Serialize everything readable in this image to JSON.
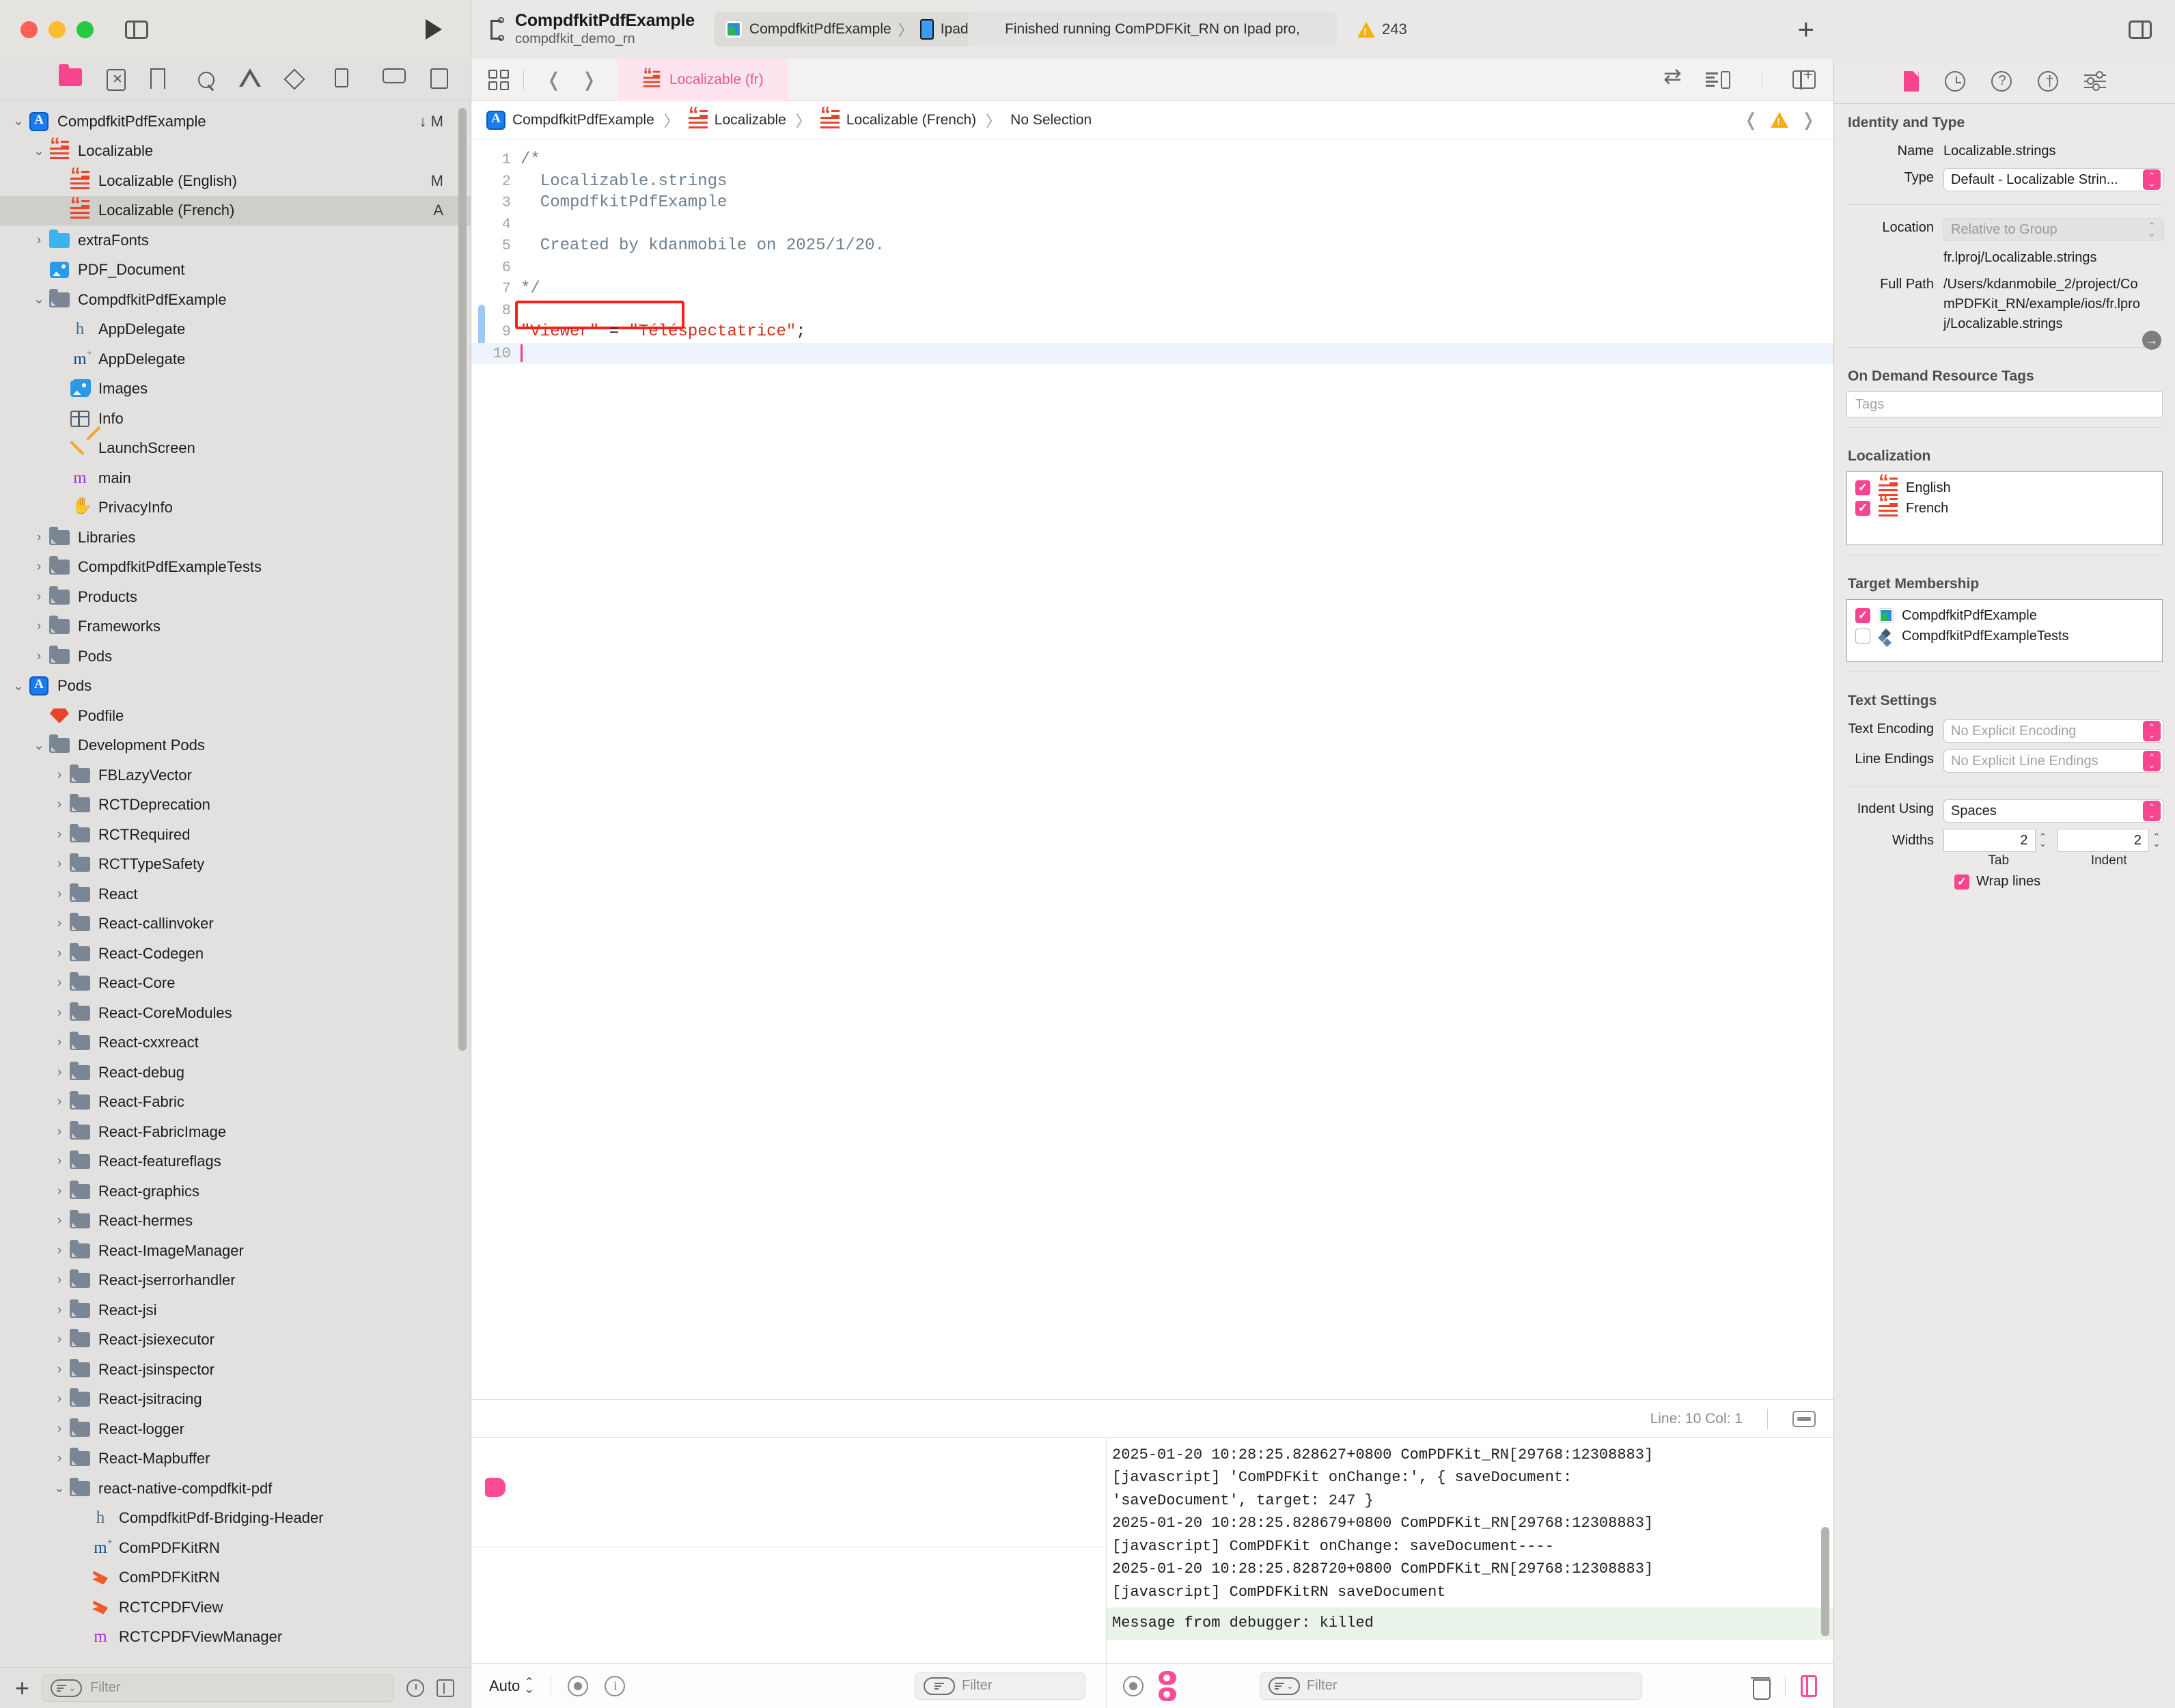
{
  "titlebar": {
    "scheme_name": "CompdfkitPdfExample",
    "scheme_sub": "compdfkit_demo_rn",
    "destination_project": "CompdfkitPdfExample",
    "destination_separator": "〉",
    "destination_device": "Ipad pro,",
    "status": "Finished running ComPDFKit_RN on Ipad pro,",
    "warning_count": "243",
    "add_label": "+"
  },
  "navigator": {
    "toolbar_icons": [
      "folder-icon",
      "source-control-icon",
      "bookmark-icon",
      "search-icon",
      "issue-icon",
      "test-icon",
      "debug-icon",
      "breakpoint-icon",
      "report-icon"
    ],
    "tree": [
      {
        "depth": 0,
        "disc": "⌄",
        "icon": "app-icon",
        "label": "CompdfkitPdfExample",
        "badge": "↓ M",
        "selected": false
      },
      {
        "depth": 1,
        "disc": "⌄",
        "icon": "strings-icon",
        "label": "Localizable",
        "badge": "",
        "selected": false
      },
      {
        "depth": 2,
        "disc": "",
        "icon": "strings-icon",
        "label": "Localizable (English)",
        "badge": "M",
        "selected": false
      },
      {
        "depth": 2,
        "disc": "",
        "icon": "strings-icon",
        "label": "Localizable (French)",
        "badge": "A",
        "selected": true
      },
      {
        "depth": 1,
        "disc": "›",
        "icon": "folder-blue-icon",
        "label": "extraFonts",
        "badge": "",
        "selected": false
      },
      {
        "depth": 1,
        "disc": "",
        "icon": "image-icon",
        "label": "PDF_Document",
        "badge": "",
        "selected": false
      },
      {
        "depth": 1,
        "disc": "⌄",
        "icon": "folder-gray-icon",
        "label": "CompdfkitPdfExample",
        "badge": "",
        "selected": false
      },
      {
        "depth": 2,
        "disc": "",
        "icon": "h-file-icon",
        "label": "AppDelegate",
        "badge": "",
        "selected": false
      },
      {
        "depth": 2,
        "disc": "",
        "icon": "m-file-icon",
        "label": "AppDelegate",
        "badge": "",
        "selected": false
      },
      {
        "depth": 2,
        "disc": "",
        "icon": "assets-icon",
        "label": "Images",
        "badge": "",
        "selected": false
      },
      {
        "depth": 2,
        "disc": "",
        "icon": "plist-icon",
        "label": "Info",
        "badge": "",
        "selected": false
      },
      {
        "depth": 2,
        "disc": "",
        "icon": "xib-icon",
        "label": "LaunchScreen",
        "badge": "",
        "selected": false
      },
      {
        "depth": 2,
        "disc": "",
        "icon": "m-purple-icon",
        "label": "main",
        "badge": "",
        "selected": false
      },
      {
        "depth": 2,
        "disc": "",
        "icon": "privacy-icon",
        "label": "PrivacyInfo",
        "badge": "",
        "selected": false
      },
      {
        "depth": 1,
        "disc": "›",
        "icon": "folder-gray-icon",
        "label": "Libraries",
        "badge": "",
        "selected": false
      },
      {
        "depth": 1,
        "disc": "›",
        "icon": "folder-gray-icon",
        "label": "CompdfkitPdfExampleTests",
        "badge": "",
        "selected": false
      },
      {
        "depth": 1,
        "disc": "›",
        "icon": "folder-gray-icon",
        "label": "Products",
        "badge": "",
        "selected": false
      },
      {
        "depth": 1,
        "disc": "›",
        "icon": "folder-gray-icon",
        "label": "Frameworks",
        "badge": "",
        "selected": false
      },
      {
        "depth": 1,
        "disc": "›",
        "icon": "folder-gray-icon",
        "label": "Pods",
        "badge": "",
        "selected": false
      },
      {
        "depth": 0,
        "disc": "⌄",
        "icon": "app-icon",
        "label": "Pods",
        "badge": "",
        "selected": false
      },
      {
        "depth": 1,
        "disc": "",
        "icon": "ruby-icon",
        "label": "Podfile",
        "badge": "",
        "selected": false
      },
      {
        "depth": 1,
        "disc": "⌄",
        "icon": "folder-gray-icon",
        "label": "Development Pods",
        "badge": "",
        "selected": false
      },
      {
        "depth": 2,
        "disc": "›",
        "icon": "folder-gray-icon",
        "label": "FBLazyVector",
        "badge": "",
        "selected": false
      },
      {
        "depth": 2,
        "disc": "›",
        "icon": "folder-gray-icon",
        "label": "RCTDeprecation",
        "badge": "",
        "selected": false
      },
      {
        "depth": 2,
        "disc": "›",
        "icon": "folder-gray-icon",
        "label": "RCTRequired",
        "badge": "",
        "selected": false
      },
      {
        "depth": 2,
        "disc": "›",
        "icon": "folder-gray-icon",
        "label": "RCTTypeSafety",
        "badge": "",
        "selected": false
      },
      {
        "depth": 2,
        "disc": "›",
        "icon": "folder-gray-icon",
        "label": "React",
        "badge": "",
        "selected": false
      },
      {
        "depth": 2,
        "disc": "›",
        "icon": "folder-gray-icon",
        "label": "React-callinvoker",
        "badge": "",
        "selected": false
      },
      {
        "depth": 2,
        "disc": "›",
        "icon": "folder-gray-icon",
        "label": "React-Codegen",
        "badge": "",
        "selected": false
      },
      {
        "depth": 2,
        "disc": "›",
        "icon": "folder-gray-icon",
        "label": "React-Core",
        "badge": "",
        "selected": false
      },
      {
        "depth": 2,
        "disc": "›",
        "icon": "folder-gray-icon",
        "label": "React-CoreModules",
        "badge": "",
        "selected": false
      },
      {
        "depth": 2,
        "disc": "›",
        "icon": "folder-gray-icon",
        "label": "React-cxxreact",
        "badge": "",
        "selected": false
      },
      {
        "depth": 2,
        "disc": "›",
        "icon": "folder-gray-icon",
        "label": "React-debug",
        "badge": "",
        "selected": false
      },
      {
        "depth": 2,
        "disc": "›",
        "icon": "folder-gray-icon",
        "label": "React-Fabric",
        "badge": "",
        "selected": false
      },
      {
        "depth": 2,
        "disc": "›",
        "icon": "folder-gray-icon",
        "label": "React-FabricImage",
        "badge": "",
        "selected": false
      },
      {
        "depth": 2,
        "disc": "›",
        "icon": "folder-gray-icon",
        "label": "React-featureflags",
        "badge": "",
        "selected": false
      },
      {
        "depth": 2,
        "disc": "›",
        "icon": "folder-gray-icon",
        "label": "React-graphics",
        "badge": "",
        "selected": false
      },
      {
        "depth": 2,
        "disc": "›",
        "icon": "folder-gray-icon",
        "label": "React-hermes",
        "badge": "",
        "selected": false
      },
      {
        "depth": 2,
        "disc": "›",
        "icon": "folder-gray-icon",
        "label": "React-ImageManager",
        "badge": "",
        "selected": false
      },
      {
        "depth": 2,
        "disc": "›",
        "icon": "folder-gray-icon",
        "label": "React-jserrorhandler",
        "badge": "",
        "selected": false
      },
      {
        "depth": 2,
        "disc": "›",
        "icon": "folder-gray-icon",
        "label": "React-jsi",
        "badge": "",
        "selected": false
      },
      {
        "depth": 2,
        "disc": "›",
        "icon": "folder-gray-icon",
        "label": "React-jsiexecutor",
        "badge": "",
        "selected": false
      },
      {
        "depth": 2,
        "disc": "›",
        "icon": "folder-gray-icon",
        "label": "React-jsinspector",
        "badge": "",
        "selected": false
      },
      {
        "depth": 2,
        "disc": "›",
        "icon": "folder-gray-icon",
        "label": "React-jsitracing",
        "badge": "",
        "selected": false
      },
      {
        "depth": 2,
        "disc": "›",
        "icon": "folder-gray-icon",
        "label": "React-logger",
        "badge": "",
        "selected": false
      },
      {
        "depth": 2,
        "disc": "›",
        "icon": "folder-gray-icon",
        "label": "React-Mapbuffer",
        "badge": "",
        "selected": false
      },
      {
        "depth": 2,
        "disc": "⌄",
        "icon": "folder-gray-icon",
        "label": "react-native-compdfkit-pdf",
        "badge": "",
        "selected": false
      },
      {
        "depth": 3,
        "disc": "",
        "icon": "h-file-icon",
        "label": "CompdfkitPdf-Bridging-Header",
        "badge": "",
        "selected": false
      },
      {
        "depth": 3,
        "disc": "",
        "icon": "m-file-icon",
        "label": "ComPDFKitRN",
        "badge": "",
        "selected": false
      },
      {
        "depth": 3,
        "disc": "",
        "icon": "swift-icon",
        "label": "ComPDFKitRN",
        "badge": "",
        "selected": false
      },
      {
        "depth": 3,
        "disc": "",
        "icon": "swift-icon",
        "label": "RCTCPDFView",
        "badge": "",
        "selected": false
      },
      {
        "depth": 3,
        "disc": "",
        "icon": "m-purple-icon",
        "label": "RCTCPDFViewManager",
        "badge": "",
        "selected": false
      }
    ],
    "filter_placeholder": "Filter",
    "add_label": "+"
  },
  "editor": {
    "tab_label": "Localizable (fr)",
    "breadcrumb": [
      {
        "icon": "app-icon",
        "label": "CompdfkitPdfExample"
      },
      {
        "icon": "strings-icon",
        "label": "Localizable"
      },
      {
        "icon": "strings-icon",
        "label": "Localizable (French)"
      },
      {
        "icon": "",
        "label": "No Selection"
      }
    ],
    "breadcrumb_separator": "〉",
    "code_lines": [
      {
        "num": "1",
        "text": "/*",
        "style": "comment"
      },
      {
        "num": "2",
        "text": "  Localizable.strings",
        "style": "comment"
      },
      {
        "num": "3",
        "text": "  CompdfkitPdfExample",
        "style": "comment"
      },
      {
        "num": "4",
        "text": "",
        "style": "comment"
      },
      {
        "num": "5",
        "text": "  Created by kdanmobile on 2025/1/20.",
        "style": "comment"
      },
      {
        "num": "6",
        "text": "",
        "style": "comment"
      },
      {
        "num": "7",
        "text": "*/",
        "style": "comment"
      },
      {
        "num": "8",
        "text": "",
        "style": "plain"
      },
      {
        "num": "9",
        "text": "\"Viewer\" = \"Téléspectatrice\";",
        "style": "strings"
      },
      {
        "num": "10",
        "text": "",
        "style": "caret"
      }
    ],
    "status_line_col": "Line: 10  Col: 1"
  },
  "console": {
    "lines": [
      "2025-01-20 10:28:25.828627+0800 ComPDFKit_RN[29768:12308883]",
      "[javascript] 'ComPDFKit onChange:', { saveDocument:",
      "'saveDocument', target: 247 }",
      "2025-01-20 10:28:25.828679+0800 ComPDFKit_RN[29768:12308883]",
      "[javascript] ComPDFKit onChange: saveDocument----",
      "2025-01-20 10:28:25.828720+0800 ComPDFKit_RN[29768:12308883]",
      "[javascript] ComPDFKitRN saveDocument"
    ],
    "highlighted_line": "Message from debugger: killed",
    "filter_placeholder": "Filter"
  },
  "bottom_bar": {
    "auto_label": "Auto",
    "filter_placeholder": "Filter"
  },
  "inspector": {
    "toolbar_icons": [
      "document-icon",
      "history-icon",
      "help-icon",
      "accessibility-icon",
      "attributes-icon"
    ],
    "identity": {
      "title": "Identity and Type",
      "name_label": "Name",
      "name_value": "Localizable.strings",
      "type_label": "Type",
      "type_value": "Default - Localizable Strin...",
      "location_label": "Location",
      "location_value": "Relative to Group",
      "location_path": "fr.lproj/Localizable.strings",
      "fullpath_label": "Full Path",
      "fullpath_value": "/Users/kdanmobile_2/project/ComPDFKit_RN/example/ios/fr.lproj/Localizable.strings"
    },
    "on_demand": {
      "title": "On Demand Resource Tags",
      "tags_placeholder": "Tags"
    },
    "localization": {
      "title": "Localization",
      "items": [
        {
          "label": "English",
          "checked": true
        },
        {
          "label": "French",
          "checked": true
        }
      ]
    },
    "target_membership": {
      "title": "Target Membership",
      "items": [
        {
          "label": "CompdfkitPdfExample",
          "checked": true,
          "icon": "target-icon"
        },
        {
          "label": "CompdfkitPdfExampleTests",
          "checked": false,
          "icon": "tests-icon"
        }
      ]
    },
    "text_settings": {
      "title": "Text Settings",
      "encoding_label": "Text Encoding",
      "encoding_value": "No Explicit Encoding",
      "endings_label": "Line Endings",
      "endings_value": "No Explicit Line Endings",
      "indent_label": "Indent Using",
      "indent_value": "Spaces",
      "widths_label": "Widths",
      "tab_width": "2",
      "indent_width": "2",
      "tab_sub": "Tab",
      "indent_sub": "Indent",
      "wrap_label": "Wrap lines",
      "wrap_checked": true
    }
  },
  "colors": {
    "accent_pink": "#f9458f",
    "highlight_red": "#fe2012",
    "warning_yellow": "#f4b012",
    "string_red": "#d12f1b",
    "comment_blue": "#6e7f8f"
  }
}
